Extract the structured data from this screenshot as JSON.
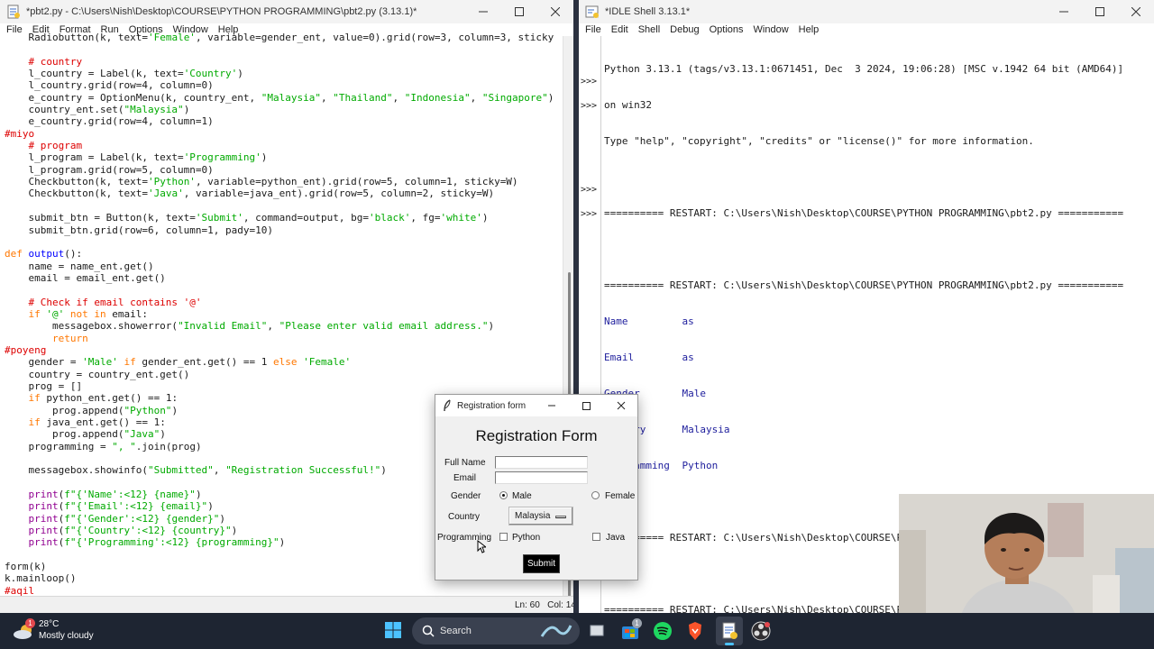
{
  "editor": {
    "title": "*pbt2.py - C:\\Users\\Nish\\Desktop\\COURSE\\PYTHON PROGRAMMING\\pbt2.py (3.13.1)*",
    "menu": [
      "File",
      "Edit",
      "Format",
      "Run",
      "Options",
      "Window",
      "Help"
    ],
    "status": "Ln: 60   Col: 14",
    "code_lines": [
      [
        [
          "n",
          "    Radiobutton(k, text="
        ],
        [
          "s",
          "'Female'"
        ],
        [
          "n",
          ", variable=gender_ent, value=0).grid(row=3, column=3, sticky"
        ]
      ],
      [
        [
          "n",
          ""
        ]
      ],
      [
        [
          "c",
          "    # country"
        ]
      ],
      [
        [
          "n",
          "    l_country = Label(k, text="
        ],
        [
          "s",
          "'Country'"
        ],
        [
          "n",
          ")"
        ]
      ],
      [
        [
          "n",
          "    l_country.grid(row=4, column=0)"
        ]
      ],
      [
        [
          "n",
          "    e_country = OptionMenu(k, country_ent, "
        ],
        [
          "s",
          "\"Malaysia\""
        ],
        [
          "n",
          ", "
        ],
        [
          "s",
          "\"Thailand\""
        ],
        [
          "n",
          ", "
        ],
        [
          "s",
          "\"Indonesia\""
        ],
        [
          "n",
          ", "
        ],
        [
          "s",
          "\"Singapore\""
        ],
        [
          "n",
          ")"
        ]
      ],
      [
        [
          "n",
          "    country_ent.set("
        ],
        [
          "s",
          "\"Malaysia\""
        ],
        [
          "n",
          ")"
        ]
      ],
      [
        [
          "n",
          "    e_country.grid(row=4, column=1)"
        ]
      ],
      [
        [
          "c",
          "#miyo"
        ]
      ],
      [
        [
          "c",
          "    # program"
        ]
      ],
      [
        [
          "n",
          "    l_program = Label(k, text="
        ],
        [
          "s",
          "'Programming'"
        ],
        [
          "n",
          ")"
        ]
      ],
      [
        [
          "n",
          "    l_program.grid(row=5, column=0)"
        ]
      ],
      [
        [
          "n",
          "    Checkbutton(k, text="
        ],
        [
          "s",
          "'Python'"
        ],
        [
          "n",
          ", variable=python_ent).grid(row=5, column=1, sticky=W)"
        ]
      ],
      [
        [
          "n",
          "    Checkbutton(k, text="
        ],
        [
          "s",
          "'Java'"
        ],
        [
          "n",
          ", variable=java_ent).grid(row=5, column=2, sticky=W)"
        ]
      ],
      [
        [
          "n",
          ""
        ]
      ],
      [
        [
          "n",
          "    submit_btn = Button(k, text="
        ],
        [
          "s",
          "'Submit'"
        ],
        [
          "n",
          ", command=output, bg="
        ],
        [
          "s",
          "'black'"
        ],
        [
          "n",
          ", fg="
        ],
        [
          "s",
          "'white'"
        ],
        [
          "n",
          ")"
        ]
      ],
      [
        [
          "n",
          "    submit_btn.grid(row=6, column=1, pady=10)"
        ]
      ],
      [
        [
          "n",
          ""
        ]
      ],
      [
        [
          "k",
          "def "
        ],
        [
          "d",
          "output"
        ],
        [
          "n",
          "():"
        ]
      ],
      [
        [
          "n",
          "    name = name_ent.get()"
        ]
      ],
      [
        [
          "n",
          "    email = email_ent.get()"
        ]
      ],
      [
        [
          "n",
          ""
        ]
      ],
      [
        [
          "c",
          "    # Check if email contains '@'"
        ]
      ],
      [
        [
          "k",
          "    if "
        ],
        [
          "s",
          "'@'"
        ],
        [
          "k",
          " not in"
        ],
        [
          "n",
          " email:"
        ]
      ],
      [
        [
          "n",
          "        messagebox.showerror("
        ],
        [
          "s",
          "\"Invalid Email\""
        ],
        [
          "n",
          ", "
        ],
        [
          "s",
          "\"Please enter valid email address.\""
        ],
        [
          "n",
          ")"
        ]
      ],
      [
        [
          "k",
          "        return"
        ]
      ],
      [
        [
          "c",
          "#poyeng"
        ]
      ],
      [
        [
          "n",
          "    gender = "
        ],
        [
          "s",
          "'Male'"
        ],
        [
          "k",
          " if"
        ],
        [
          "n",
          " gender_ent.get() == 1 "
        ],
        [
          "k",
          "else"
        ],
        [
          "n",
          " "
        ],
        [
          "s",
          "'Female'"
        ]
      ],
      [
        [
          "n",
          "    country = country_ent.get()"
        ]
      ],
      [
        [
          "n",
          "    prog = []"
        ]
      ],
      [
        [
          "k",
          "    if"
        ],
        [
          "n",
          " python_ent.get() == 1:"
        ]
      ],
      [
        [
          "n",
          "        prog.append("
        ],
        [
          "s",
          "\"Python\""
        ],
        [
          "n",
          ")"
        ]
      ],
      [
        [
          "k",
          "    if"
        ],
        [
          "n",
          " java_ent.get() == 1:"
        ]
      ],
      [
        [
          "n",
          "        prog.append("
        ],
        [
          "s",
          "\"Java\""
        ],
        [
          "n",
          ")"
        ]
      ],
      [
        [
          "n",
          "    programming = "
        ],
        [
          "s",
          "\", \""
        ],
        [
          "n",
          ".join(prog)"
        ]
      ],
      [
        [
          "n",
          ""
        ]
      ],
      [
        [
          "n",
          "    messagebox.showinfo("
        ],
        [
          "s",
          "\"Submitted\""
        ],
        [
          "n",
          ", "
        ],
        [
          "s",
          "\"Registration Successful!\""
        ],
        [
          "n",
          ")"
        ]
      ],
      [
        [
          "n",
          ""
        ]
      ],
      [
        [
          "b",
          "    print"
        ],
        [
          "n",
          "("
        ],
        [
          "s",
          "f\"{'Name':<12} {name}\""
        ],
        [
          "n",
          ")"
        ]
      ],
      [
        [
          "b",
          "    print"
        ],
        [
          "n",
          "("
        ],
        [
          "s",
          "f\"{'Email':<12} {email}\""
        ],
        [
          "n",
          ")"
        ]
      ],
      [
        [
          "b",
          "    print"
        ],
        [
          "n",
          "("
        ],
        [
          "s",
          "f\"{'Gender':<12} {gender}\""
        ],
        [
          "n",
          ")"
        ]
      ],
      [
        [
          "b",
          "    print"
        ],
        [
          "n",
          "("
        ],
        [
          "s",
          "f\"{'Country':<12} {country}\""
        ],
        [
          "n",
          ")"
        ]
      ],
      [
        [
          "b",
          "    print"
        ],
        [
          "n",
          "("
        ],
        [
          "s",
          "f\"{'Programming':<12} {programming}\""
        ],
        [
          "n",
          ")"
        ]
      ],
      [
        [
          "n",
          ""
        ]
      ],
      [
        [
          "n",
          "form(k)"
        ]
      ],
      [
        [
          "n",
          "k.mainloop()"
        ]
      ],
      [
        [
          "c",
          "#aqil"
        ]
      ]
    ]
  },
  "shell": {
    "title": "*IDLE Shell 3.13.1*",
    "menu": [
      "File",
      "Edit",
      "Shell",
      "Debug",
      "Options",
      "Window",
      "Help"
    ],
    "prompt": ">>>",
    "banner1": "Python 3.13.1 (tags/v3.13.1:0671451, Dec  3 2024, 19:06:28) [MSC v.1942 64 bit (AMD64)]",
    "banner2": "on win32",
    "banner3": "Type \"help\", \"copyright\", \"credits\" or \"license()\" for more information.",
    "restart": "========== RESTART: C:\\Users\\Nish\\Desktop\\COURSE\\PYTHON PROGRAMMING\\pbt2.py ===========",
    "output": [
      {
        "key": "Name",
        "value": "as"
      },
      {
        "key": "Email",
        "value": "as"
      },
      {
        "key": "Gender",
        "value": "Male"
      },
      {
        "key": "Country",
        "value": "Malaysia"
      },
      {
        "key": "Programming",
        "value": "Python"
      }
    ]
  },
  "form": {
    "window_title": "Registration form",
    "heading": "Registration Form",
    "full_name_label": "Full Name",
    "email_label": "Email",
    "gender_label": "Gender",
    "gender_male": "Male",
    "gender_female": "Female",
    "gender_selected": "Male",
    "country_label": "Country",
    "country_value": "Malaysia",
    "programming_label": "Programming",
    "prog_python": "Python",
    "prog_java": "Java",
    "submit_label": "Submit",
    "full_name_value": "",
    "email_value": ""
  },
  "taskbar": {
    "temperature": "28°C",
    "weather": "Mostly cloudy",
    "weather_badge": "1",
    "search_label": "Search",
    "store_badge": "1"
  },
  "colors": {
    "keyword": "#ff7700",
    "string": "#00aa00",
    "comment": "#dd0000",
    "builtin": "#900090",
    "definition": "#0000ff",
    "shell_output": "#1d1d9c",
    "taskbar": "#1e2532"
  }
}
